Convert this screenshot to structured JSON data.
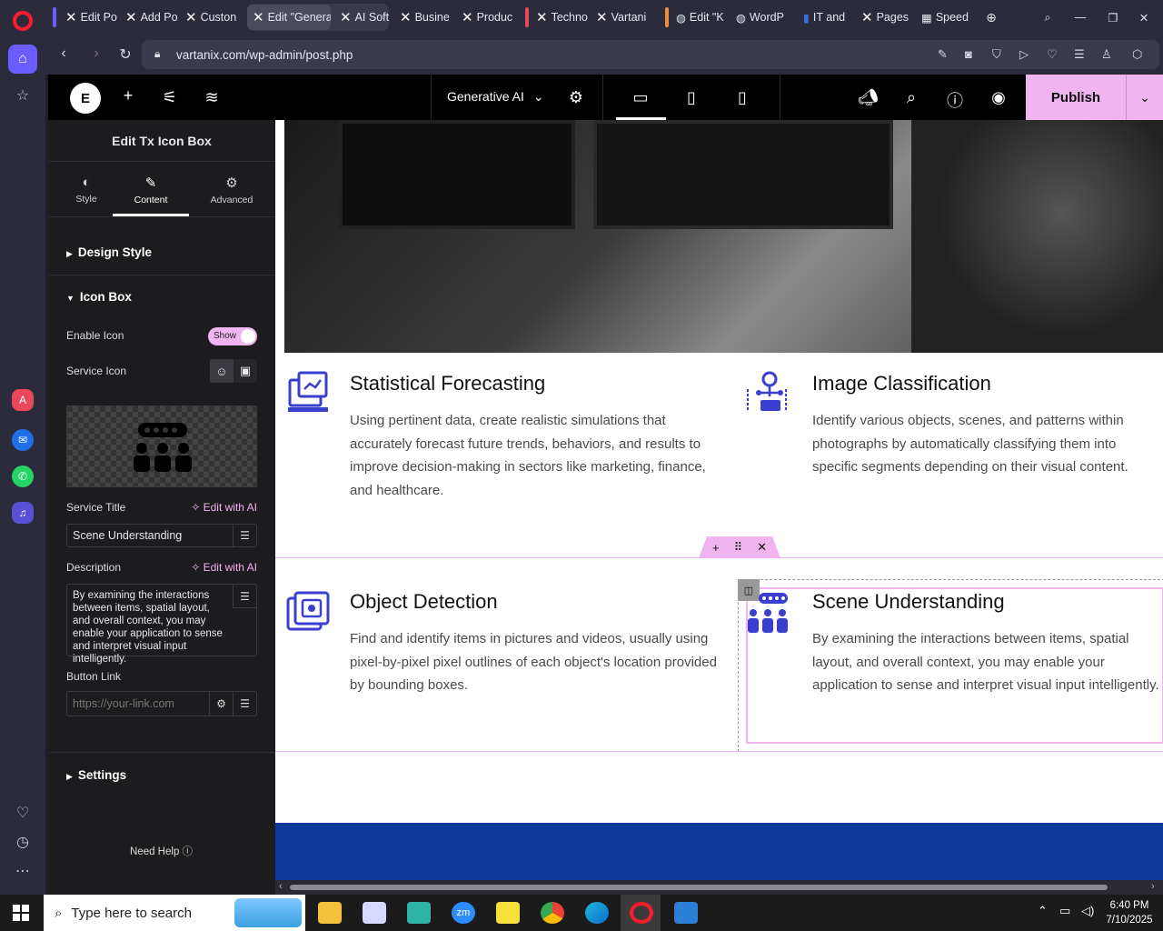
{
  "tabs": [
    {
      "label": "Edit Po",
      "icon": "x-icon"
    },
    {
      "label": "Add Po",
      "icon": "x-icon"
    },
    {
      "label": "Custon",
      "icon": "x-icon"
    },
    {
      "label": "Edit \"Genera",
      "icon": "x-icon",
      "active": true
    },
    {
      "label": "AI Soft",
      "icon": "x-icon"
    },
    {
      "label": "Busine",
      "icon": "x-icon"
    },
    {
      "label": "Produc",
      "icon": "x-icon"
    },
    {
      "label": "Techno",
      "icon": "x-icon"
    },
    {
      "label": "Vartani",
      "icon": "x-icon"
    },
    {
      "label": "Edit \"K",
      "icon": "wordpress-icon"
    },
    {
      "label": "WordP",
      "icon": "wordpress-icon"
    },
    {
      "label": "IT and",
      "icon": "document-icon"
    },
    {
      "label": "Pages",
      "icon": "x-icon"
    },
    {
      "label": "Speed",
      "icon": "grid-icon"
    }
  ],
  "address": {
    "url": "vartanix.com/wp-admin/post.php"
  },
  "topbar": {
    "page_name": "Generative AI",
    "publish_label": "Publish"
  },
  "panel": {
    "title": "Edit Tx Icon Box",
    "tabs": {
      "style": "Style",
      "content": "Content",
      "advanced": "Advanced"
    },
    "design_style": "Design Style",
    "icon_box": "Icon Box",
    "enable_icon_label": "Enable Icon",
    "enable_icon_value": "Show",
    "service_icon_label": "Service Icon",
    "service_title_label": "Service Title",
    "edit_ai": "Edit with AI",
    "service_title_value": "Scene Understanding",
    "description_label": "Description",
    "description_value": "By examining the interactions between items, spatial layout, and overall context, you may enable your application to sense and interpret visual input intelligently.",
    "button_link_label": "Button Link",
    "button_link_placeholder": "https://your-link.com",
    "settings": "Settings",
    "need_help": "Need Help"
  },
  "services": [
    {
      "title": "Statistical Forecasting",
      "description": "Using pertinent data, create realistic simulations that accurately forecast future trends, behaviors, and results to improve decision-making in sectors like marketing, finance, and healthcare."
    },
    {
      "title": "Image Classification",
      "description": "Identify various objects, scenes, and patterns within photographs by automatically classifying them into specific segments depending on their visual content."
    },
    {
      "title": "Object Detection",
      "description": "Find and identify items in pictures and videos, usually using pixel-by-pixel pixel outlines of each object's location provided by bounding boxes."
    },
    {
      "title": "Scene Understanding",
      "description": "By examining the interactions between items, spatial layout, and overall context, you may enable your application to sense and interpret visual input intelligently."
    }
  ],
  "taskbar": {
    "search_placeholder": "Type here to search",
    "time": "6:40 PM",
    "date": "7/10/2025"
  },
  "colors": {
    "accent": "#f0b4f0",
    "icon_blue": "#3a3fd0",
    "footer": "#0d3a9a"
  }
}
